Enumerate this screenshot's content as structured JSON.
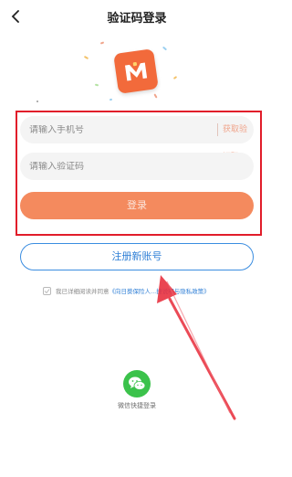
{
  "header": {
    "title": "验证码登录",
    "back_icon": "chevron-left-icon"
  },
  "brand": {
    "logo_icon": "app-logo-m",
    "color": "#f26a3b"
  },
  "form": {
    "phone_placeholder": "请输入手机号",
    "code_placeholder": "请输入验证码",
    "get_code_label": "获取验证码",
    "login_label": "登录",
    "register_label": "注册新账号"
  },
  "agreement": {
    "prefix": "我已详细阅读并同意",
    "link": "《向日葵保险人...捷说明与隐私政策》"
  },
  "social": {
    "wechat_label": "微信快捷登录",
    "wechat_icon": "wechat-icon"
  },
  "colors": {
    "accent": "#f48a5e",
    "link": "#2f7fd6",
    "highlight": "#e11d2a",
    "wechat": "#3bc24b"
  }
}
